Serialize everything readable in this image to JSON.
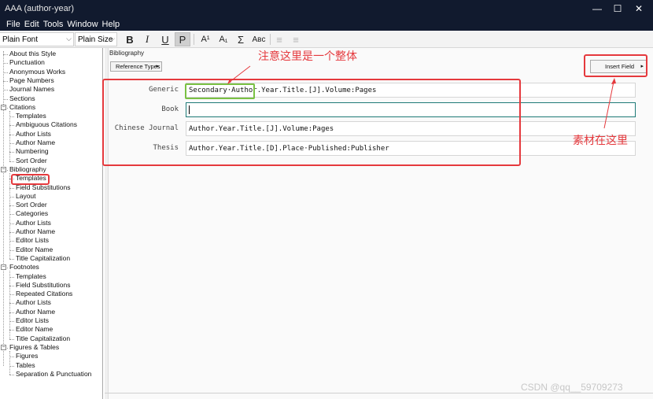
{
  "window": {
    "title": "AAA (author-year)",
    "minimize": "—",
    "maximize": "☐",
    "close": "✕"
  },
  "menu": [
    "File",
    "Edit",
    "Tools",
    "Window",
    "Help"
  ],
  "toolbar": {
    "font": "Plain Font",
    "size": "Plain Size",
    "bold": "B",
    "italic": "I",
    "underline": "U",
    "plain": "P",
    "superscript": "A¹",
    "subscript": "A₁",
    "sigma": "Σ",
    "smallcaps": "Aʙᴄ",
    "align_left": "≡",
    "align_justify": "≡"
  },
  "tree": {
    "items": [
      {
        "label": "About this Style",
        "level": 1
      },
      {
        "label": "Punctuation",
        "level": 1
      },
      {
        "label": "Anonymous Works",
        "level": 1
      },
      {
        "label": "Page Numbers",
        "level": 1
      },
      {
        "label": "Journal Names",
        "level": 1
      },
      {
        "label": "Sections",
        "level": 1
      },
      {
        "label": "Citations",
        "level": 0
      },
      {
        "label": "Templates",
        "level": 2
      },
      {
        "label": "Ambiguous Citations",
        "level": 2
      },
      {
        "label": "Author Lists",
        "level": 2
      },
      {
        "label": "Author Name",
        "level": 2
      },
      {
        "label": "Numbering",
        "level": 2
      },
      {
        "label": "Sort Order",
        "level": 2
      },
      {
        "label": "Bibliography",
        "level": 0
      },
      {
        "label": "Templates",
        "level": 2
      },
      {
        "label": "Field Substitutions",
        "level": 2
      },
      {
        "label": "Layout",
        "level": 2
      },
      {
        "label": "Sort Order",
        "level": 2
      },
      {
        "label": "Categories",
        "level": 2
      },
      {
        "label": "Author Lists",
        "level": 2
      },
      {
        "label": "Author Name",
        "level": 2
      },
      {
        "label": "Editor Lists",
        "level": 2
      },
      {
        "label": "Editor Name",
        "level": 2
      },
      {
        "label": "Title Capitalization",
        "level": 2
      },
      {
        "label": "Footnotes",
        "level": 0
      },
      {
        "label": "Templates",
        "level": 2
      },
      {
        "label": "Field Substitutions",
        "level": 2
      },
      {
        "label": "Repeated Citations",
        "level": 2
      },
      {
        "label": "Author Lists",
        "level": 2
      },
      {
        "label": "Author Name",
        "level": 2
      },
      {
        "label": "Editor Lists",
        "level": 2
      },
      {
        "label": "Editor Name",
        "level": 2
      },
      {
        "label": "Title Capitalization",
        "level": 2
      },
      {
        "label": "Figures & Tables",
        "level": 0
      },
      {
        "label": "Figures",
        "level": 2
      },
      {
        "label": "Tables",
        "level": 2
      },
      {
        "label": "Separation & Punctuation",
        "level": 2
      }
    ],
    "expander_symbol": "−"
  },
  "main": {
    "section_label": "Bibliography",
    "reference_types_button": "Reference Types",
    "insert_field_button": "Insert Field",
    "arrow": "▸",
    "templates": [
      {
        "label": "Generic",
        "prefix": "Secondary·Author",
        "value": ".Year.Title.[J].Volume:Pages"
      },
      {
        "label": "Book",
        "value": ""
      },
      {
        "label": "Chinese Journal",
        "value": "Author.Year.Title.[J].Volume:Pages"
      },
      {
        "label": "Thesis",
        "value": "Author.Year.Title.[D].Place·Published:Publisher"
      }
    ]
  },
  "annotations": {
    "top_note": "注意这里是一个整体",
    "side_note": "素材在这里",
    "colors": {
      "red": "#e5393d",
      "green": "#7ac143"
    }
  },
  "watermark": "CSDN @qq__59709273"
}
